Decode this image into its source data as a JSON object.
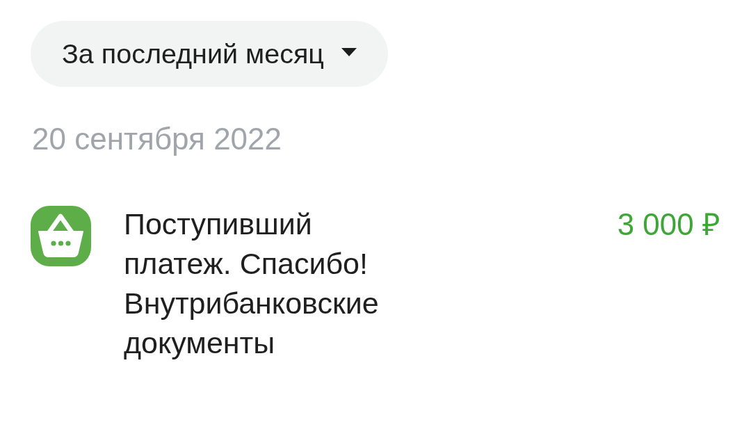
{
  "filter": {
    "label": "За последний месяц",
    "expanded": false
  },
  "groups": [
    {
      "date": "20 сентября 2022",
      "transactions": [
        {
          "kind": "income",
          "description": "Поступивший платеж. Спасибо! Внутрибанковские документы",
          "amount": "3 000 ₽"
        }
      ]
    }
  ]
}
